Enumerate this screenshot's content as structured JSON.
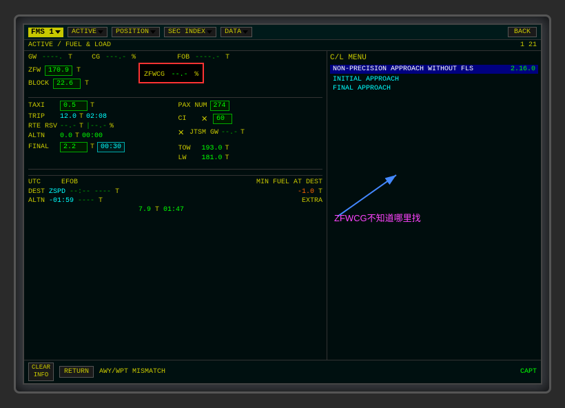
{
  "topBar": {
    "fmsLabel": "FMS 1",
    "activeLabel": "ACTIVE",
    "positionLabel": "POSITION",
    "secIndexLabel": "SEC INDEX",
    "dataLabel": "DATA",
    "backLabel": "BACK"
  },
  "secondBar": {
    "pathLabel": "ACTIVE / FUEL & LOAD",
    "pageNum": "1 21"
  },
  "leftPanel": {
    "gwLabel": "GW",
    "gwValue": "----.",
    "gwUnit": "T",
    "cgLabel": "CG",
    "cgValue": "---.-",
    "cgUnit": "%",
    "fobLabel": "FOB",
    "fobValue": "----.-",
    "fobUnit": "T",
    "zfwLabel": "ZFW",
    "zfwValue": "170.9",
    "zfwUnit": "T",
    "blockLabel": "BLOCK",
    "blockValue": "22.6",
    "blockUnit": "T",
    "zfwcgLabel": "ZFWCG",
    "zfwcgValue": "--.-",
    "zfwcgUnit": "%",
    "taxiLabel": "TAXI",
    "taxiValue": "0.5",
    "taxiUnit": "T",
    "tripLabel": "TRIP",
    "tripValue": "12.0",
    "tripUnit": "T",
    "tripTime": "02:08",
    "rteRsvLabel": "RTE RSV",
    "rteRsvValue": "--.-",
    "rteRsvUnit": "T",
    "rteRsvPct": "-.-",
    "rteRsvPctUnit": "%",
    "altnLabel": "ALTN",
    "altnValue": "0.0",
    "altnUnit": "T",
    "altnTime": "00:00",
    "finalLabel": "FINAL",
    "finalValue": "2.2",
    "finalUnit": "T",
    "finalTime": "00:30",
    "paxNumLabel": "PAX NUM",
    "paxNumValue": "274",
    "ciLabel": "CI",
    "ciValue": "60",
    "jtsm_gwLabel": "JTSM GW",
    "jtsm_gwValue": "--.-",
    "jtsm_gwUnit": "T",
    "towLabel": "TOW",
    "towValue": "193.0",
    "towUnit": "T",
    "lwLabel": "LW",
    "lwValue": "181.0",
    "lwUnit": "T",
    "utcLabel": "UTC",
    "efobLabel": "EFOB",
    "minFuelLabel": "MIN FUEL AT DEST",
    "minFuelValue": "-1.0",
    "minFuelUnit": "T",
    "extraLabel": "EXTRA",
    "destLabel": "DEST",
    "destCode": "ZSPD",
    "destDashes": "--:--",
    "destEfob": "----",
    "destEfobUnit": "T",
    "altnLabel2": "ALTN",
    "altnTime2": "-01:59",
    "altnEfob": "----",
    "altnEfobUnit": "T",
    "extraValue": "7.9",
    "extraUnit": "T",
    "extraTime": "01:47"
  },
  "rightPanel": {
    "clMenuLabel": "C/L MENU",
    "approachText": "NON-PRECISION APPROACH WITHOUT FLS",
    "approachVersion": "2.16.0",
    "initialApproach": "INITIAL APPROACH",
    "finalApproach": "FINAL APPROACH"
  },
  "bottomBar": {
    "returnLabel": "RETURN",
    "mismatchText": "AWY/WPT MISMATCH",
    "clearInfoLabel": "CLEAR\nINFO",
    "captLabel": "CAPT"
  },
  "annotation": {
    "text": "ZFWCG不知道哪里找",
    "arrowColor": "#4488ff"
  }
}
